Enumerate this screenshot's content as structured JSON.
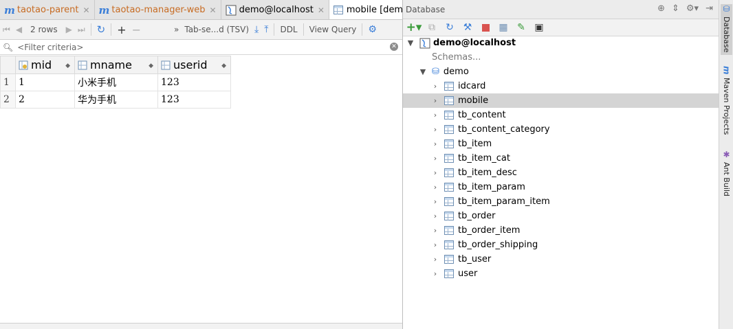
{
  "editor_tabs": [
    {
      "label": "taotao-parent",
      "icon": "maven-module-icon",
      "active": false
    },
    {
      "label": "taotao-manager-web",
      "icon": "maven-module-icon",
      "active": false
    },
    {
      "label": "demo@localhost",
      "icon": "database-console-icon",
      "active": false
    },
    {
      "label": "mobile [demo@lo",
      "icon": "table-icon",
      "active": true
    }
  ],
  "results_toolbar": {
    "rows_label": "2 rows",
    "export_format": "Tab-se...d (TSV)",
    "ddl_label": "DDL",
    "view_query_label": "View Query"
  },
  "filter": {
    "placeholder": "<Filter criteria>"
  },
  "grid": {
    "columns": [
      {
        "name": "mid",
        "icon": "primary-key-column-icon"
      },
      {
        "name": "mname",
        "icon": "column-icon"
      },
      {
        "name": "userid",
        "icon": "column-icon"
      }
    ],
    "rows": [
      {
        "num": "1",
        "cells": [
          "1",
          "小米手机",
          "123"
        ]
      },
      {
        "num": "2",
        "cells": [
          "2",
          "华为手机",
          "123"
        ]
      }
    ]
  },
  "database_panel": {
    "title": "Database",
    "connection": "demo@localhost",
    "schemas_label": "Schemas...",
    "schema": "demo",
    "tables": [
      "idcard",
      "mobile",
      "tb_content",
      "tb_content_category",
      "tb_item",
      "tb_item_cat",
      "tb_item_desc",
      "tb_item_param",
      "tb_item_param_item",
      "tb_order",
      "tb_order_item",
      "tb_order_shipping",
      "tb_user",
      "user"
    ],
    "selected_table": "mobile"
  },
  "side_tools": [
    {
      "label": "Database",
      "icon": "database-icon"
    },
    {
      "label": "Maven Projects",
      "icon": "maven-icon"
    },
    {
      "label": "Ant Build",
      "icon": "ant-icon"
    }
  ],
  "colors": {
    "accent": "#3c7fd8",
    "selection": "#d4d4d4",
    "add_green": "#3a9b3a",
    "stop_red": "#d9534f"
  }
}
